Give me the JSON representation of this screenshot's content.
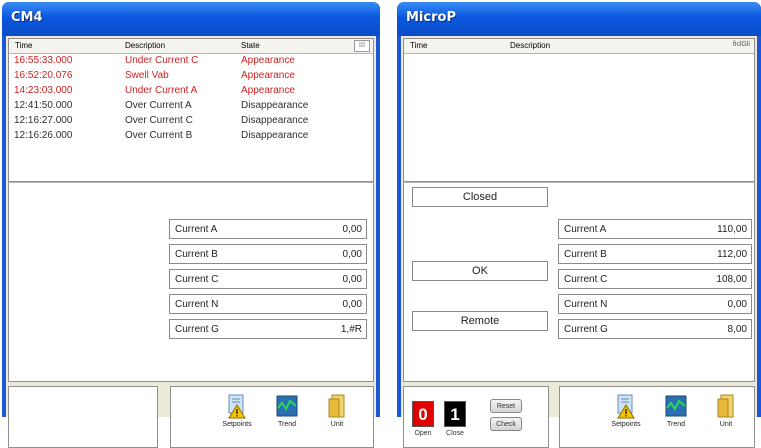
{
  "colors": {
    "titlebar": "#0b58e0",
    "alarm_active": "#d0211f",
    "alarm_cleared": "#2f2f2f",
    "panel_bg": "#ece9d8",
    "open_indicator": "#e00000",
    "close_indicator": "#000000"
  },
  "cm4": {
    "title": "CM4",
    "list_headers": {
      "time": "Time",
      "description": "Description",
      "state": "State",
      "button": "☒"
    },
    "events": [
      {
        "time": "16:55:33.000",
        "description": "Under Current C",
        "state": "Appearance",
        "active": true
      },
      {
        "time": "16:52:20.076",
        "description": "Swell Vab",
        "state": "Appearance",
        "active": true
      },
      {
        "time": "14:23:03.000",
        "description": "Under Current A",
        "state": "Appearance",
        "active": true
      },
      {
        "time": "12:41:50.000",
        "description": "Over Current A",
        "state": "Disappearance",
        "active": false
      },
      {
        "time": "12:16:27.000",
        "description": "Over Current C",
        "state": "Disappearance",
        "active": false
      },
      {
        "time": "12:16:26.000",
        "description": "Over Current B",
        "state": "Disappearance",
        "active": false
      }
    ],
    "measurements": [
      {
        "label": "Current A",
        "value": "0,00"
      },
      {
        "label": "Current B",
        "value": "0,00"
      },
      {
        "label": "Current C",
        "value": "0,00"
      },
      {
        "label": "Current N",
        "value": "0,00"
      },
      {
        "label": "Current G",
        "value": "1,#R"
      }
    ],
    "tools": [
      {
        "label": "Setpoints",
        "icon": "setpoints-icon"
      },
      {
        "label": "Trend",
        "icon": "trend-icon"
      },
      {
        "label": "Unit",
        "icon": "unit-icon"
      }
    ]
  },
  "microp": {
    "title": "MicroP",
    "list_headers": {
      "time": "Time",
      "description": "Description",
      "button": "ficlGli"
    },
    "status": {
      "breaker": "Closed",
      "health": "OK",
      "mode": "Remote"
    },
    "measurements": [
      {
        "label": "Current A",
        "value": "110,00"
      },
      {
        "label": "Current B",
        "value": "112,00"
      },
      {
        "label": "Current C",
        "value": "108,00"
      },
      {
        "label": "Current N",
        "value": "0,00"
      },
      {
        "label": "Current G",
        "value": "8,00"
      }
    ],
    "controls": {
      "open_digit": "0",
      "open_label": "Open",
      "close_digit": "1",
      "close_label": "Close",
      "reset_label": "Reset",
      "check_label": "Check"
    },
    "tools": [
      {
        "label": "Setpoints",
        "icon": "setpoints-icon"
      },
      {
        "label": "Trend",
        "icon": "trend-icon"
      },
      {
        "label": "Unit",
        "icon": "unit-icon"
      }
    ]
  }
}
